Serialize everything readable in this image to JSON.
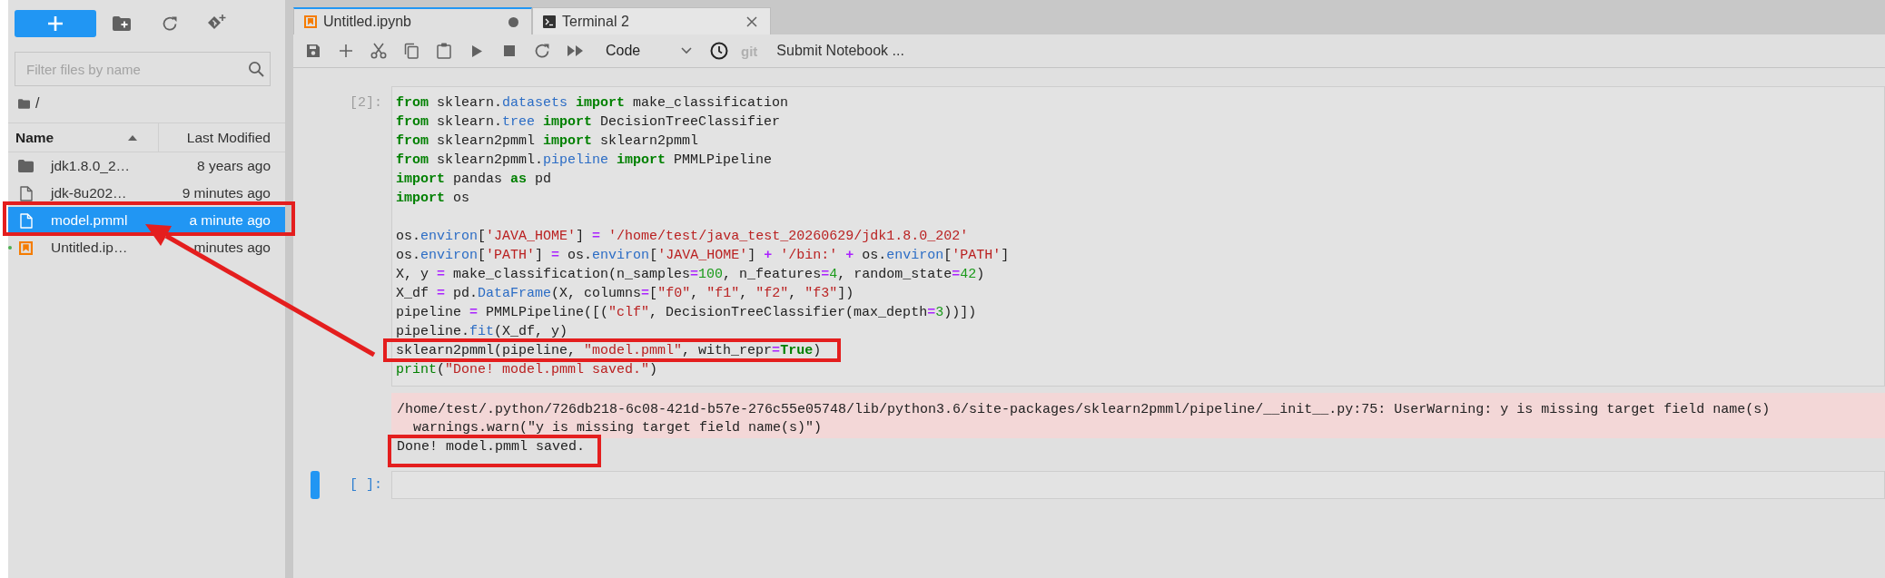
{
  "sidebar": {
    "filter": {
      "placeholder": "Filter files by name"
    },
    "path": "/",
    "columns": [
      {
        "label": "Name",
        "sorted": true
      },
      {
        "label": "Last Modified",
        "sorted": false
      }
    ],
    "files": [
      {
        "kind": "folder",
        "name": "jdk1.8.0_2…",
        "modified": "8 years ago",
        "selected": false,
        "running": false,
        "marked": false
      },
      {
        "kind": "file",
        "name": "jdk-8u202…",
        "modified": "9 minutes ago",
        "selected": false,
        "running": false,
        "marked": false
      },
      {
        "kind": "file",
        "name": "model.pmml",
        "modified": "a minute ago",
        "selected": true,
        "running": false,
        "marked": true
      },
      {
        "kind": "notebook",
        "name": "Untitled.ip…",
        "modified": "minutes ago",
        "selected": false,
        "running": true,
        "marked": false
      }
    ]
  },
  "tabs": [
    {
      "kind": "notebook",
      "label": "Untitled.ipynb",
      "selected": true,
      "dirty": true
    },
    {
      "kind": "terminal",
      "label": "Terminal 2",
      "selected": false,
      "dirty": false
    }
  ],
  "toolbar": {
    "cell_type": "Code",
    "git": {
      "label": "git",
      "disabled": true
    },
    "submit": "Submit Notebook ..."
  },
  "cells": [
    {
      "prompt": "[2]:",
      "active": false,
      "lines": [
        {
          "kind": "code",
          "marked": false,
          "tokens": [
            {
              "kind": "kw",
              "text": "from"
            },
            {
              "kind": "text",
              "text": " sklearn."
            },
            {
              "kind": "attr",
              "text": "datasets"
            },
            {
              "kind": "kw",
              "text": " import"
            },
            {
              "kind": "text",
              "text": " make_classification"
            }
          ]
        },
        {
          "kind": "code",
          "marked": false,
          "tokens": [
            {
              "kind": "kw",
              "text": "from"
            },
            {
              "kind": "text",
              "text": " sklearn."
            },
            {
              "kind": "attr",
              "text": "tree"
            },
            {
              "kind": "kw",
              "text": " import"
            },
            {
              "kind": "text",
              "text": " DecisionTreeClassifier"
            }
          ]
        },
        {
          "kind": "code",
          "marked": false,
          "tokens": [
            {
              "kind": "kw",
              "text": "from"
            },
            {
              "kind": "text",
              "text": " sklearn2pmml "
            },
            {
              "kind": "kw",
              "text": "import"
            },
            {
              "kind": "text",
              "text": " sklearn2pmml"
            }
          ]
        },
        {
          "kind": "code",
          "marked": false,
          "tokens": [
            {
              "kind": "kw",
              "text": "from"
            },
            {
              "kind": "text",
              "text": " sklearn2pmml."
            },
            {
              "kind": "attr",
              "text": "pipeline"
            },
            {
              "kind": "kw",
              "text": " import"
            },
            {
              "kind": "text",
              "text": " PMMLPipeline"
            }
          ]
        },
        {
          "kind": "code",
          "marked": false,
          "tokens": [
            {
              "kind": "kw",
              "text": "import"
            },
            {
              "kind": "text",
              "text": " pandas "
            },
            {
              "kind": "kw",
              "text": "as"
            },
            {
              "kind": "text",
              "text": " pd"
            }
          ]
        },
        {
          "kind": "code",
          "marked": false,
          "tokens": [
            {
              "kind": "kw",
              "text": "import"
            },
            {
              "kind": "text",
              "text": " os"
            }
          ]
        },
        {
          "kind": "blank"
        },
        {
          "kind": "code",
          "marked": false,
          "tokens": [
            {
              "kind": "text",
              "text": "os."
            },
            {
              "kind": "attr",
              "text": "environ"
            },
            {
              "kind": "text",
              "text": "["
            },
            {
              "kind": "str",
              "text": "'JAVA_HOME'"
            },
            {
              "kind": "text",
              "text": "] "
            },
            {
              "kind": "op",
              "text": "= "
            },
            {
              "kind": "str",
              "text": "'/home/test/java_test_20260629/jdk1.8.0_202'"
            }
          ]
        },
        {
          "kind": "code",
          "marked": false,
          "tokens": [
            {
              "kind": "text",
              "text": "os."
            },
            {
              "kind": "attr",
              "text": "environ"
            },
            {
              "kind": "text",
              "text": "["
            },
            {
              "kind": "str",
              "text": "'PATH'"
            },
            {
              "kind": "text",
              "text": "] "
            },
            {
              "kind": "op",
              "text": "="
            },
            {
              "kind": "text",
              "text": " os."
            },
            {
              "kind": "attr",
              "text": "environ"
            },
            {
              "kind": "text",
              "text": "["
            },
            {
              "kind": "str",
              "text": "'JAVA_HOME'"
            },
            {
              "kind": "text",
              "text": "] "
            },
            {
              "kind": "op",
              "text": "+ "
            },
            {
              "kind": "str",
              "text": "'/bin:'"
            },
            {
              "kind": "op",
              "text": " +"
            },
            {
              "kind": "text",
              "text": " os."
            },
            {
              "kind": "attr",
              "text": "environ"
            },
            {
              "kind": "text",
              "text": "["
            },
            {
              "kind": "str",
              "text": "'PATH'"
            },
            {
              "kind": "text",
              "text": "]"
            }
          ]
        },
        {
          "kind": "code",
          "marked": false,
          "tokens": [
            {
              "kind": "text",
              "text": "X, y "
            },
            {
              "kind": "op",
              "text": "="
            },
            {
              "kind": "text",
              "text": " make_classification(n_samples"
            },
            {
              "kind": "op",
              "text": "="
            },
            {
              "kind": "num",
              "text": "100"
            },
            {
              "kind": "text",
              "text": ", n_features"
            },
            {
              "kind": "op",
              "text": "="
            },
            {
              "kind": "num",
              "text": "4"
            },
            {
              "kind": "text",
              "text": ", random_state"
            },
            {
              "kind": "op",
              "text": "="
            },
            {
              "kind": "num",
              "text": "42"
            },
            {
              "kind": "text",
              "text": ")"
            }
          ]
        },
        {
          "kind": "code",
          "marked": false,
          "tokens": [
            {
              "kind": "text",
              "text": "X_df "
            },
            {
              "kind": "op",
              "text": "="
            },
            {
              "kind": "text",
              "text": " pd."
            },
            {
              "kind": "attr",
              "text": "DataFrame"
            },
            {
              "kind": "text",
              "text": "(X, columns"
            },
            {
              "kind": "op",
              "text": "="
            },
            {
              "kind": "text",
              "text": "["
            },
            {
              "kind": "str",
              "text": "\"f0\""
            },
            {
              "kind": "text",
              "text": ", "
            },
            {
              "kind": "str",
              "text": "\"f1\""
            },
            {
              "kind": "text",
              "text": ", "
            },
            {
              "kind": "str",
              "text": "\"f2\""
            },
            {
              "kind": "text",
              "text": ", "
            },
            {
              "kind": "str",
              "text": "\"f3\""
            },
            {
              "kind": "text",
              "text": "])"
            }
          ]
        },
        {
          "kind": "code",
          "marked": false,
          "tokens": [
            {
              "kind": "text",
              "text": "pipeline "
            },
            {
              "kind": "op",
              "text": "="
            },
            {
              "kind": "text",
              "text": " PMMLPipeline([("
            },
            {
              "kind": "str",
              "text": "\"clf\""
            },
            {
              "kind": "text",
              "text": ", DecisionTreeClassifier(max_depth"
            },
            {
              "kind": "op",
              "text": "="
            },
            {
              "kind": "num",
              "text": "3"
            },
            {
              "kind": "text",
              "text": "))])"
            }
          ]
        },
        {
          "kind": "code",
          "marked": false,
          "tokens": [
            {
              "kind": "text",
              "text": "pipeline."
            },
            {
              "kind": "attr",
              "text": "fit"
            },
            {
              "kind": "text",
              "text": "(X_df, y)"
            }
          ]
        },
        {
          "kind": "code",
          "marked": true,
          "tokens": [
            {
              "kind": "text",
              "text": "sklearn2pmml(pipeline, "
            },
            {
              "kind": "str",
              "text": "\"model.pmml\""
            },
            {
              "kind": "text",
              "text": ", with_repr"
            },
            {
              "kind": "op",
              "text": "="
            },
            {
              "kind": "kw",
              "text": "True"
            },
            {
              "kind": "text",
              "text": ")"
            }
          ]
        },
        {
          "kind": "code",
          "marked": false,
          "tokens": [
            {
              "kind": "builtin",
              "text": "print"
            },
            {
              "kind": "text",
              "text": "("
            },
            {
              "kind": "str",
              "text": "\"Done! model.pmml saved.\""
            },
            {
              "kind": "text",
              "text": ")"
            }
          ]
        }
      ],
      "outputs": [
        {
          "kind": "stderr",
          "lines": [
            {
              "text": "/home/test/.python/726db218-6c08-421d-b57e-276c55e05748/lib/python3.6/site-packages/sklearn2pmml/pipeline/__init__.py:75: UserWarning: y is missing target field name(s)",
              "marked": false
            },
            {
              "text": "  warnings.warn(\"y is missing target field name(s)\")",
              "marked": false
            }
          ]
        },
        {
          "kind": "stdout",
          "lines": [
            {
              "text": "Done! model.pmml saved.",
              "marked": true
            }
          ]
        }
      ]
    },
    {
      "prompt": "[ ]:",
      "active": true
    }
  ],
  "annotation_arrow": true
}
